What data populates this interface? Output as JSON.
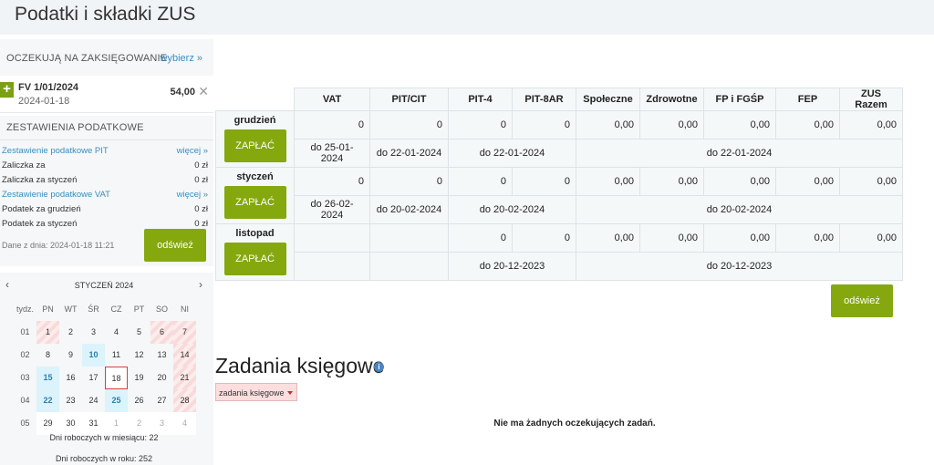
{
  "title": "Podatki i składki ZUS",
  "pending": {
    "header": "OCZEKUJĄ NA ZAKSIĘGOWANIE",
    "link": "wybierz »",
    "item": {
      "title": "FV 1/01/2024",
      "date": "2024-01-18",
      "amount": "54,00"
    }
  },
  "summary": {
    "header": "ZESTAWIENIA PODATKOWE",
    "pit_link": "Zestawienie podatkowe PIT",
    "pit_more": "więcej »",
    "vat_link": "Zestawienie podatkowe VAT",
    "vat_more": "więcej »",
    "rows_pit": [
      {
        "label": "Zaliczka za",
        "value": "0 zł"
      },
      {
        "label": "Zaliczka za styczeń",
        "value": "0 zł"
      }
    ],
    "rows_vat": [
      {
        "label": "Podatek za grudzień",
        "value": "0 zł"
      },
      {
        "label": "Podatek za styczeń",
        "value": "0 zł"
      }
    ],
    "stamp": "Dane z dnia: 2024-01-18 11:21",
    "refresh": "odśwież"
  },
  "calendar": {
    "month": "STYCZEŃ 2024",
    "prev": "‹",
    "next": "›",
    "headers": [
      "tydz.",
      "PN",
      "WT",
      "ŚR",
      "CZ",
      "PT",
      "SO",
      "NI"
    ],
    "weeks": [
      {
        "wk": "01",
        "days": [
          "1",
          "2",
          "3",
          "4",
          "5",
          "6",
          "7"
        ]
      },
      {
        "wk": "02",
        "days": [
          "8",
          "9",
          "10",
          "11",
          "12",
          "13",
          "14"
        ]
      },
      {
        "wk": "03",
        "days": [
          "15",
          "16",
          "17",
          "18",
          "19",
          "20",
          "21"
        ]
      },
      {
        "wk": "04",
        "days": [
          "22",
          "23",
          "24",
          "25",
          "26",
          "27",
          "28"
        ]
      },
      {
        "wk": "05",
        "days": [
          "29",
          "30",
          "31",
          "1",
          "2",
          "3",
          "4"
        ]
      }
    ],
    "footer1": "Dni roboczych w miesiącu: 22",
    "footer2": "Dni roboczych w roku: 252"
  },
  "table": {
    "columns": [
      "VAT",
      "PIT/CIT",
      "PIT-4",
      "PIT-8AR",
      "Społeczne",
      "Zdrowotne",
      "FP i FGŚP",
      "FEP",
      "ZUS Razem"
    ],
    "pay_label": "ZAPŁAĆ",
    "months": [
      {
        "name": "grudzień",
        "values": [
          "0",
          "0",
          "0",
          "0",
          "0,00",
          "0,00",
          "0,00",
          "0,00",
          "0,00"
        ],
        "due_vat": "do 25-01-2024",
        "due_pit": "do 22-01-2024",
        "due_pit4": "do 22-01-2024",
        "due_zus": "do 22-01-2024"
      },
      {
        "name": "styczeń",
        "values": [
          "0",
          "0",
          "0",
          "0",
          "0,00",
          "0,00",
          "0,00",
          "0,00",
          "0,00"
        ],
        "due_vat": "do 26-02-2024",
        "due_pit": "do 20-02-2024",
        "due_pit4": "do 20-02-2024",
        "due_zus": "do 20-02-2024"
      },
      {
        "name": "listopad",
        "values": [
          "",
          "",
          "0",
          "0",
          "0,00",
          "0,00",
          "0,00",
          "0,00",
          "0,00"
        ],
        "due_vat": "",
        "due_pit": "",
        "due_pit4": "do 20-12-2023",
        "due_zus": "do 20-12-2023"
      }
    ],
    "refresh": "odśwież"
  },
  "tasks": {
    "title": "Zadania księgowe",
    "info": "i",
    "dropdown": "zadania księgowe",
    "empty": "Nie ma żadnych oczekujących zadań."
  }
}
